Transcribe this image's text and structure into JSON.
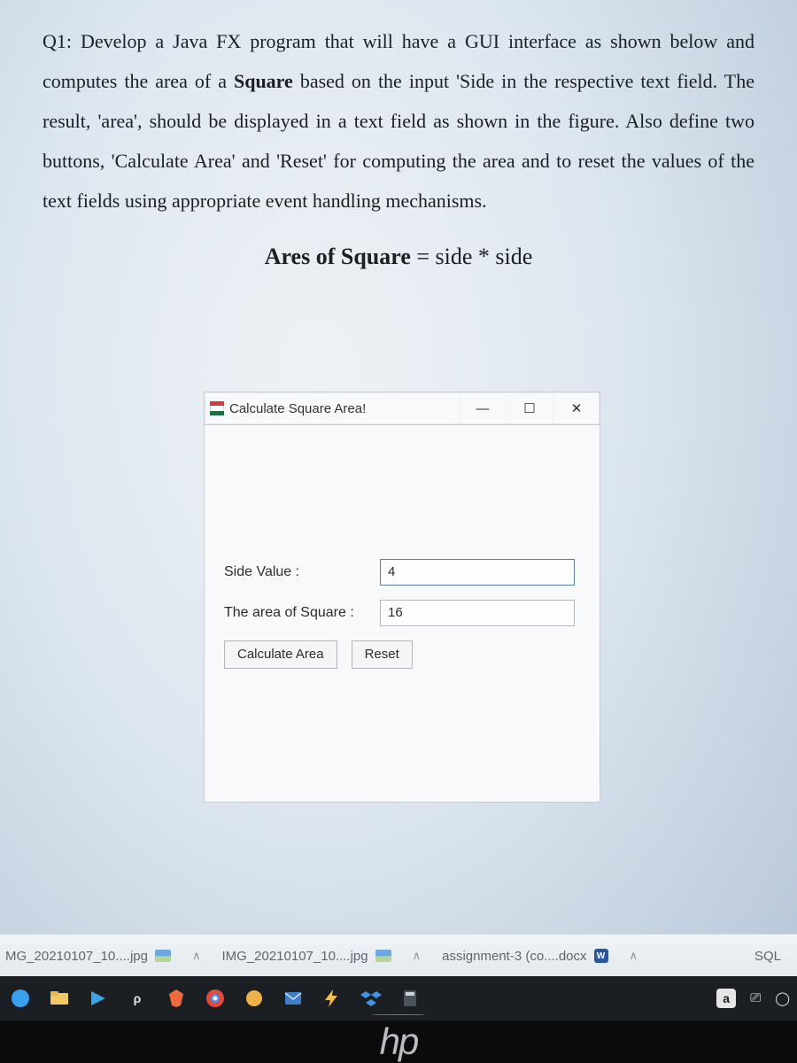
{
  "question": {
    "prefix": "Q1: ",
    "text_part_a": "Develop a Java FX program that will have a GUI interface as shown below and computes the area of a ",
    "bold_a": "Square",
    "text_part_b": " based on the input 'Side in the respective text field. The result, 'area', should be displayed in a text field as shown in the figure. Also define two buttons, 'Calculate Area' and 'Reset' for computing the area and to reset the values of the text fields using appropriate event handling mechanisms."
  },
  "formula": {
    "lhs": "Ares of Square",
    "rhs": "side * side"
  },
  "mock": {
    "title": "Calculate Square Area!",
    "minimize": "—",
    "maximize": "☐",
    "close": "✕",
    "side_label": "Side Value :",
    "side_value": "4",
    "area_label": "The area of Square :",
    "area_value": "16",
    "calc_btn": "Calculate Area",
    "reset_btn": "Reset"
  },
  "downloads": {
    "item1": "MG_20210107_10....jpg",
    "item2": "IMG_20210107_10....jpg",
    "item3": "assignment-3 (co....docx",
    "item4": "SQL",
    "chev": "∧"
  },
  "tray": {
    "a": "a"
  },
  "bezel": {
    "logo": "hp"
  }
}
